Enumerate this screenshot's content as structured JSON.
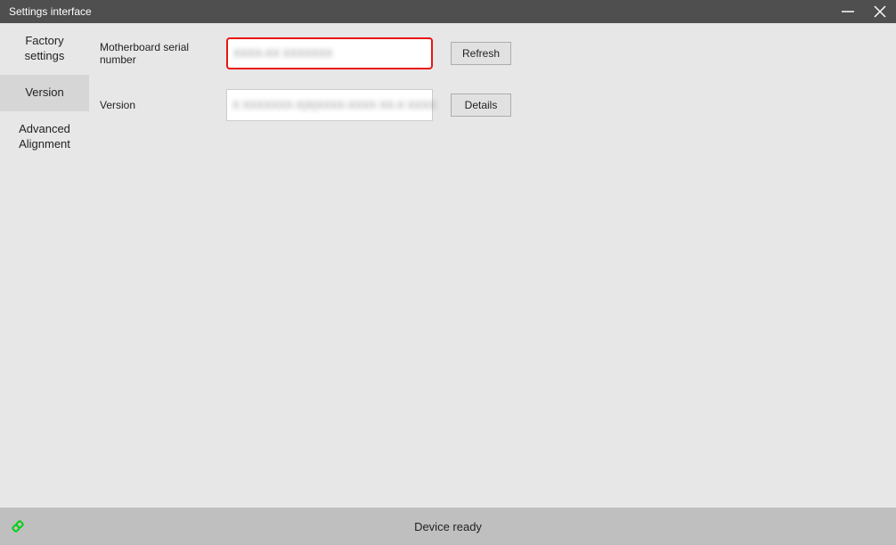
{
  "window": {
    "title": "Settings interface"
  },
  "sidebar": {
    "items": [
      {
        "label": "Factory settings"
      },
      {
        "label": "Version"
      },
      {
        "label": "Advanced Alignment"
      }
    ],
    "active_index": 1
  },
  "main": {
    "serial": {
      "label": "Motherboard serial number",
      "value": "XXXX-XX XXXXXXX",
      "button": "Refresh"
    },
    "version": {
      "label": "Version",
      "value": "X XXXXXXX-X|X|XXXX-XXXX XX-X XXXX",
      "button": "Details"
    }
  },
  "status": {
    "text": "Device ready"
  }
}
